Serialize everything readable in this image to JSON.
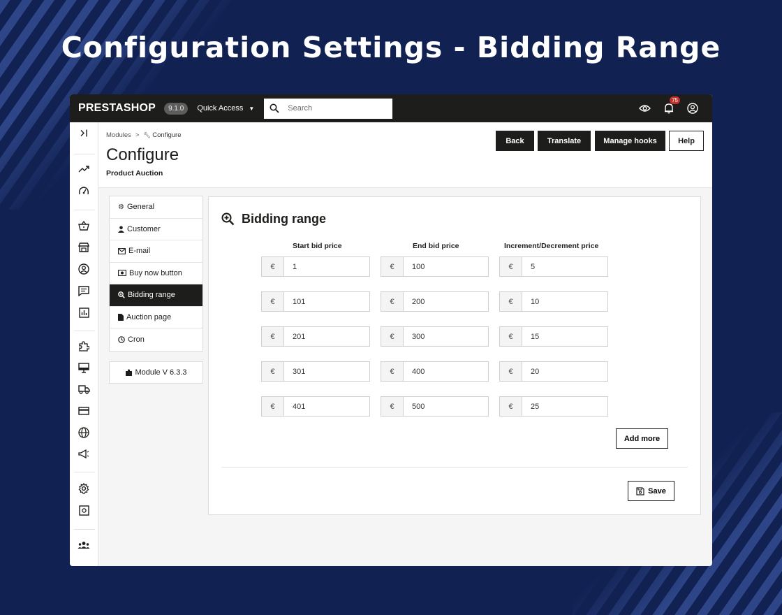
{
  "banner": {
    "title": "Configuration Settings - Bidding Range"
  },
  "topbar": {
    "brand": "PRESTASHOP",
    "version": "9.1.0",
    "quick_access": "Quick Access",
    "search_placeholder": "Search",
    "notifications_count": "75"
  },
  "header": {
    "breadcrumb": [
      "Modules",
      ">",
      "Configure"
    ],
    "title": "Configure",
    "subtitle": "Product Auction",
    "buttons": {
      "back": "Back",
      "translate": "Translate",
      "manage_hooks": "Manage hooks",
      "help": "Help"
    }
  },
  "leftnav": {
    "items": [
      {
        "label": "General",
        "icon": "gears-icon"
      },
      {
        "label": "Customer",
        "icon": "user-icon"
      },
      {
        "label": "E-mail",
        "icon": "envelope-icon"
      },
      {
        "label": "Buy now button",
        "icon": "money-icon"
      },
      {
        "label": "Bidding range",
        "icon": "search-plus-icon",
        "active": true
      },
      {
        "label": "Auction page",
        "icon": "file-icon"
      },
      {
        "label": "Cron",
        "icon": "clock-icon"
      }
    ],
    "module_version": "Module V 6.3.3"
  },
  "panel": {
    "title": "Bidding range",
    "columns": {
      "start": "Start bid price",
      "end": "End bid price",
      "increment": "Increment/Decrement price"
    },
    "currency": "€",
    "rows": [
      {
        "start": "1",
        "end": "100",
        "increment": "5"
      },
      {
        "start": "101",
        "end": "200",
        "increment": "10"
      },
      {
        "start": "201",
        "end": "300",
        "increment": "15"
      },
      {
        "start": "301",
        "end": "400",
        "increment": "20"
      },
      {
        "start": "401",
        "end": "500",
        "increment": "25"
      }
    ],
    "add_more": "Add more",
    "save": "Save"
  },
  "colors": {
    "dark": "#1d1d1b",
    "background": "#112152",
    "badge": "#c0332d"
  }
}
